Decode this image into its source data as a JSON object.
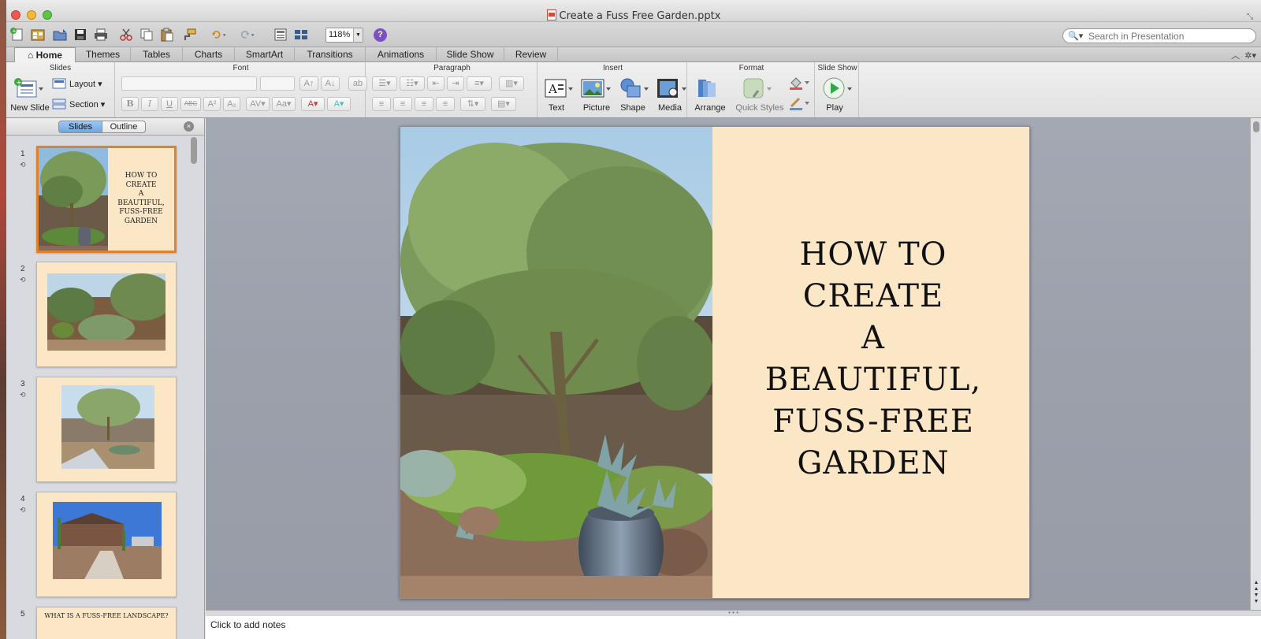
{
  "window": {
    "title": "Create a Fuss Free Garden.pptx"
  },
  "toolbar": {
    "zoom": "118%",
    "search_placeholder": "Search in Presentation"
  },
  "ribbon_tabs": [
    "Home",
    "Themes",
    "Tables",
    "Charts",
    "SmartArt",
    "Transitions",
    "Animations",
    "Slide Show",
    "Review"
  ],
  "ribbon": {
    "slides_group": "Slides",
    "new_slide": "New Slide",
    "layout": "Layout",
    "section": "Section",
    "font_group": "Font",
    "paragraph_group": "Paragraph",
    "insert_group": "Insert",
    "insert_text": "Text",
    "insert_picture": "Picture",
    "insert_shape": "Shape",
    "insert_media": "Media",
    "format_group": "Format",
    "arrange": "Arrange",
    "quick_styles": "Quick Styles",
    "slideshow_group": "Slide Show",
    "play": "Play",
    "bold": "B",
    "italic": "I",
    "underline": "U",
    "strike": "ABC"
  },
  "pane": {
    "slides_tab": "Slides",
    "outline_tab": "Outline",
    "slides": [
      {
        "num": "1",
        "title": "HOW TO CREATE A BEAUTIFUL, FUSS-FREE GARDEN"
      },
      {
        "num": "2",
        "title": ""
      },
      {
        "num": "3",
        "title": ""
      },
      {
        "num": "4",
        "title": ""
      },
      {
        "num": "5",
        "title": "WHAT IS A FUSS-FREE LANDSCAPE?"
      }
    ]
  },
  "thumb1": {
    "l1": "HOW TO",
    "l2": "CREATE",
    "l3": "A",
    "l4": "BEAUTIFUL,",
    "l5": "FUSS-FREE",
    "l6": "GARDEN"
  },
  "slide": {
    "line1": "HOW TO",
    "line2": "CREATE",
    "line3": "A",
    "line4": "BEAUTIFUL,",
    "line5": "FUSS-FREE",
    "line6": "GARDEN"
  },
  "notes": {
    "placeholder": "Click to add notes"
  },
  "colors": {
    "slide_bg": "#fbe7c6",
    "selected_border": "#e0812b",
    "workspace": "#a0a4af"
  }
}
